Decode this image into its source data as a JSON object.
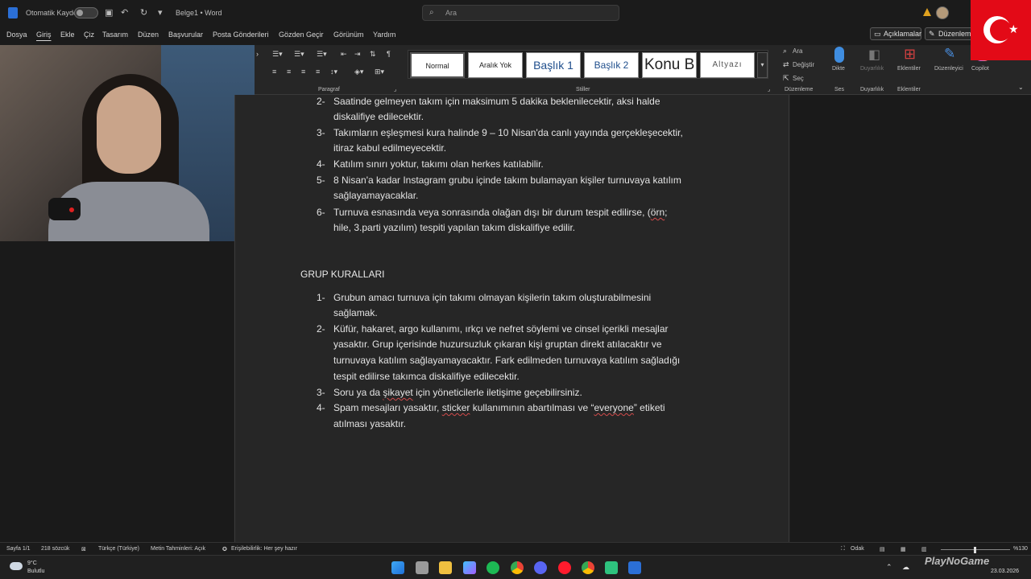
{
  "titlebar": {
    "autosave_label": "Otomatik Kaydet",
    "doc_title": "Belge1 • Word",
    "search_placeholder": "Ara"
  },
  "menu": {
    "tabs": [
      "Dosya",
      "Giriş",
      "Ekle",
      "Çiz",
      "Tasarım",
      "Düzen",
      "Başvurular",
      "Posta Gönderileri",
      "Gözden Geçir",
      "Görünüm",
      "Yardım"
    ],
    "active_tab": "Giriş",
    "comments_button": "Açıklamalar",
    "editing_button": "Düzenlem"
  },
  "ribbon": {
    "group_paragraph": "Paragraf",
    "group_styles": "Stiller",
    "styles": [
      "Normal",
      "Aralık Yok",
      "Başlık 1",
      "Başlık 2",
      "Konu B",
      "Altyazı"
    ],
    "find": "Ara",
    "replace": "Değiştir",
    "select": "Seç",
    "group_editing": "Düzenleme",
    "dictate": "Dikte",
    "group_voice": "Ses",
    "sensitivity": "Duyarlılık",
    "group_sensitivity": "Duyarlılık",
    "addins": "Eklentiler",
    "group_addins": "Eklentiler",
    "editor": "Düzenleyici",
    "copilot": "Copilot"
  },
  "document": {
    "items_top": [
      {
        "num": "2-",
        "lines": [
          "Saatinde gelmeyen takım için maksimum 5 dakika beklenilecektir, aksi halde",
          "diskalifiye edilecektir."
        ]
      },
      {
        "num": "3-",
        "lines": [
          "Takımların eşleşmesi kura halinde 9 – 10 Nisan'da canlı yayında gerçekleşecektir,",
          "itiraz kabul edilmeyecektir."
        ]
      },
      {
        "num": "4-",
        "lines": [
          "Katılım sınırı yoktur, takımı olan herkes katılabilir."
        ]
      },
      {
        "num": "5-",
        "lines": [
          "8 Nisan'a kadar Instagram grubu içinde takım bulamayan kişiler turnuvaya katılım",
          "sağlayamayacaklar."
        ]
      },
      {
        "num": "6-",
        "lines": [
          "Turnuva esnasında veya sonrasında olağan dışı bir durum tespit edilirse, (örn;",
          "hile, 3.parti yazılım) tespiti yapılan takım diskalifiye edilir."
        ]
      }
    ],
    "heading": "GRUP KURALLARI",
    "items_bottom": [
      {
        "num": "1-",
        "lines": [
          "Grubun amacı turnuva için takımı olmayan kişilerin takım oluşturabilmesini",
          "sağlamak."
        ]
      },
      {
        "num": "2-",
        "lines": [
          "Küfür, hakaret, argo kullanımı, ırkçı ve nefret söylemi ve cinsel içerikli mesajlar",
          "yasaktır. Grup içerisinde huzursuzluk çıkaran kişi gruptan direkt atılacaktır ve",
          "turnuvaya katılım sağlayamayacaktır. Fark edilmeden turnuvaya katılım sağladığı",
          "tespit edilirse takımca diskalifiye edilecektir."
        ]
      },
      {
        "num": "3-",
        "lines": [
          "Soru ya da şikayet için yöneticilerle iletişime geçebilirsiniz."
        ]
      },
      {
        "num": "4-",
        "lines": [
          "Spam mesajları yasaktır, sticker kullanımının abartılması ve “everyone” etiketi",
          "atılması yasaktır."
        ]
      }
    ]
  },
  "statusbar": {
    "page": "Sayfa 1/1",
    "words": "218 sözcük",
    "language": "Türkçe (Türkiye)",
    "predictions": "Metin Tahminleri: Açık",
    "accessibility": "Erişilebilirlik: Her şey hazır",
    "focus": "Odak",
    "zoom": "%130",
    "zoom_level_fraction": 0.48
  },
  "taskbar": {
    "temp": "9°C",
    "weather": "Bulutlu",
    "date": "23.03.2026"
  },
  "watermark": "PlayNoGame",
  "colors": {
    "accent_flag": "#e30a17",
    "app_blue": "#2b6fd6",
    "squiggle": "#d24b4b"
  }
}
